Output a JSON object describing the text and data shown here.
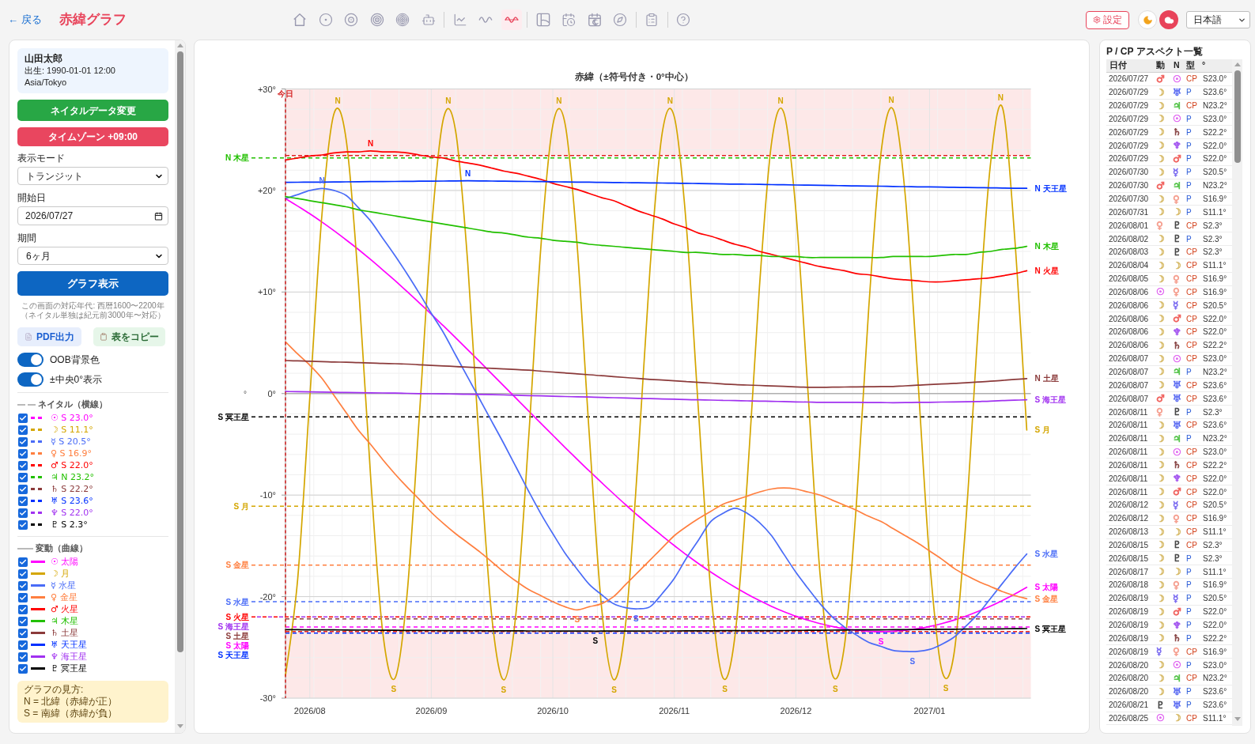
{
  "header": {
    "back_link": "← 戻る",
    "title": "赤緯グラフ",
    "toolbar": [
      [
        {
          "kind": "home",
          "selected": false
        },
        {
          "kind": "circle-dot",
          "selected": false
        },
        {
          "kind": "rings-2",
          "selected": false
        },
        {
          "kind": "rings-3",
          "selected": false
        },
        {
          "kind": "rings-4",
          "selected": false
        },
        {
          "kind": "robot",
          "selected": false
        }
      ],
      [
        {
          "kind": "line-chart",
          "selected": false
        },
        {
          "kind": "wave",
          "selected": false
        },
        {
          "kind": "wave-axis",
          "selected": true
        }
      ],
      [
        {
          "kind": "grid",
          "selected": false
        },
        {
          "kind": "calendar-clock",
          "selected": false
        },
        {
          "kind": "calendar-moon",
          "selected": false
        },
        {
          "kind": "compass",
          "selected": false
        }
      ],
      [
        {
          "kind": "clipboard",
          "selected": false
        }
      ],
      [
        {
          "kind": "help",
          "selected": false
        }
      ]
    ],
    "settings": "設定",
    "theme_buttons": [
      {
        "kind": "moon",
        "selected": false
      },
      {
        "kind": "cloud",
        "selected": true
      }
    ],
    "language": "日本語"
  },
  "sidebar": {
    "profile": {
      "name": "山田太郎",
      "birth": "出生: 1990-01-01 12:00",
      "timezone": "Asia/Tokyo"
    },
    "actions": [
      {
        "label": "ネイタルデータ変更",
        "color": "#28a745"
      },
      {
        "label": "タイムゾーン +09:00",
        "color": "#e9465f"
      }
    ],
    "fields": [
      {
        "label": "表示モード",
        "kind": "select",
        "value": "トランジット"
      },
      {
        "label": "開始日",
        "kind": "date",
        "value": "2026/07/27"
      },
      {
        "label": "期間",
        "kind": "select",
        "value": "6ヶ月"
      }
    ],
    "submit": "グラフ表示",
    "note": "この画面の対応年代: 西暦1600〜2200年（ネイタル単独は紀元前3000年〜対応）",
    "exports": [
      {
        "label": "PDF出力",
        "kind": "pdf"
      },
      {
        "label": "表をコピー",
        "kind": "copy"
      }
    ],
    "toggles": [
      {
        "label": "OOB背景色",
        "on": true
      },
      {
        "label": "±中央0°表示",
        "on": true
      }
    ],
    "natal_legend": {
      "title": "ネイタル（横線）",
      "items": [
        {
          "label": "☉ S 23.0°",
          "color": "#ff00ff",
          "checked": true
        },
        {
          "label": "☽ S 11.1°",
          "color": "#d4a600",
          "checked": true
        },
        {
          "label": "☿ S 20.5°",
          "color": "#4a6cf7",
          "checked": true
        },
        {
          "label": "♀ S 16.9°",
          "color": "#ff7f3f",
          "checked": true
        },
        {
          "label": "♂ S 22.0°",
          "color": "#ff0000",
          "checked": true
        },
        {
          "label": "♃ N 23.2°",
          "color": "#22c000",
          "checked": true
        },
        {
          "label": "♄ S 22.2°",
          "color": "#8b3a3a",
          "checked": true
        },
        {
          "label": "♅ S 23.6°",
          "color": "#0030ff",
          "checked": true
        },
        {
          "label": "♆ S 22.0°",
          "color": "#a030f0",
          "checked": true
        },
        {
          "label": "♇ S 2.3°",
          "color": "#000000",
          "checked": true
        }
      ]
    },
    "transit_legend": {
      "title": "変動（曲線）",
      "items": [
        {
          "label": "☉ 太陽",
          "color": "#ff00ff",
          "checked": true
        },
        {
          "label": "☽ 月",
          "color": "#d4a600",
          "checked": true
        },
        {
          "label": "☿ 水星",
          "color": "#4a6cf7",
          "checked": true
        },
        {
          "label": "♀ 金星",
          "color": "#ff7f3f",
          "checked": true
        },
        {
          "label": "♂ 火星",
          "color": "#ff0000",
          "checked": true
        },
        {
          "label": "♃ 木星",
          "color": "#22c000",
          "checked": true
        },
        {
          "label": "♄ 土星",
          "color": "#8b3a3a",
          "checked": true
        },
        {
          "label": "♅ 天王星",
          "color": "#0030ff",
          "checked": true
        },
        {
          "label": "♆ 海王星",
          "color": "#a030f0",
          "checked": true
        },
        {
          "label": "♇ 冥王星",
          "color": "#000000",
          "checked": true
        }
      ]
    },
    "help": {
      "title": "グラフの見方:",
      "lines": [
        "N = 北緯（赤緯が正）",
        "S = 南緯（赤緯が負）"
      ]
    }
  },
  "chart_panel": {
    "chart_data": {
      "type": "line",
      "title": "赤緯（±符号付き・0°中心）",
      "ylabel": "°",
      "grid": true,
      "categories": [
        null,
        null,
        "2026/08",
        null,
        null,
        null,
        null,
        null,
        null,
        null,
        null,
        null,
        "2026/09",
        null,
        null,
        null,
        null,
        null,
        null,
        null,
        null,
        null,
        "2026/10",
        null,
        null,
        null,
        null,
        null,
        null,
        null,
        null,
        null,
        "2026/11",
        null,
        null,
        null,
        null,
        null,
        null,
        null,
        null,
        null,
        "2026/12",
        null,
        null,
        null,
        null,
        null,
        null,
        null,
        null,
        null,
        null,
        "2027/01",
        null,
        null,
        null,
        null,
        null,
        null,
        null,
        null
      ],
      "ylim": [
        -30,
        30
      ],
      "yticks": [
        {
          "value": 30,
          "label": "+30°"
        },
        {
          "value": 20,
          "label": "+20°"
        },
        {
          "value": 10,
          "label": "+10°"
        },
        {
          "value": 0,
          "label": "0°"
        },
        {
          "value": -10,
          "label": "-10°"
        },
        {
          "value": -20,
          "label": "-20°"
        },
        {
          "value": -30,
          "label": "-30°"
        }
      ],
      "series": [
        {
          "name": "S 太陽",
          "color": "#ff00ff",
          "values": [
            19.2,
            18.47,
            17.71,
            16.89,
            16.03,
            15.13,
            14.19,
            13.2,
            12.18,
            11.14,
            10.05,
            8.95,
            7.82,
            6.66,
            5.5,
            4.31,
            3.12,
            1.91,
            0.71,
            -0.5,
            -1.71,
            -2.92,
            -4.11,
            -5.3,
            -6.47,
            -7.63,
            -8.76,
            -9.87,
            -10.96,
            -12.01,
            -13.03,
            -14.02,
            -14.97,
            -15.89,
            -16.76,
            -17.58,
            -18.35,
            -19.08,
            -19.76,
            -20.38,
            -20.96,
            -21.47,
            -21.93,
            -22.33,
            -22.66,
            -22.94,
            -23.16,
            -23.32,
            -23.41,
            -23.44,
            -23.41,
            -23.31,
            -23.16,
            -22.94,
            -22.66,
            -22.32,
            -21.92,
            -21.46,
            -20.95,
            -20.38,
            -19.76,
            -19.08
          ]
        },
        {
          "name": "S 月",
          "color": "#d4a600",
          "values": [
            -27.77,
            -18.3,
            -0.45,
            17.61,
            27.6,
            24.97,
            10.93,
            -8.12,
            -23.45,
            -28.06,
            -19.83,
            -2.53,
            15.93,
            27.1,
            25.87,
            12.81,
            -6.11,
            -22.23,
            -28.19,
            -21.24,
            -4.59,
            14.17,
            26.45,
            26.63,
            14.62,
            -4.07,
            -20.9,
            -28.17,
            -22.55,
            -6.63,
            12.34,
            25.66,
            27.24,
            16.36,
            -2.0,
            -19.45,
            -28.0,
            -23.74,
            -8.63,
            10.44,
            24.72,
            27.7,
            18.01,
            0.07,
            -17.89,
            -27.67,
            -24.8,
            -10.58,
            8.48,
            23.67,
            28.01,
            19.54,
            2.15,
            -16.24,
            -27.2,
            -25.72,
            -12.47,
            6.48,
            22.46,
            28.18,
            15.5,
            -3.6
          ]
        },
        {
          "name": "S 水星",
          "color": "#4a6cf7",
          "values": [
            19.2,
            19.6,
            20.0,
            20.2,
            20.0,
            19.5,
            18.3,
            17.0,
            15.3,
            13.6,
            11.8,
            9.9,
            7.9,
            6.0,
            3.8,
            1.6,
            -0.6,
            -2.8,
            -5.0,
            -7.3,
            -9.6,
            -11.8,
            -13.8,
            -15.7,
            -17.3,
            -18.8,
            -19.8,
            -20.7,
            -21.1,
            -21.2,
            -21.0,
            -19.7,
            -18.2,
            -16.2,
            -14.4,
            -12.6,
            -11.8,
            -11.3,
            -11.8,
            -12.7,
            -14.0,
            -15.8,
            -17.6,
            -19.2,
            -20.7,
            -22.0,
            -23.0,
            -23.8,
            -24.5,
            -24.9,
            -25.3,
            -25.4,
            -25.4,
            -25.2,
            -24.7,
            -24.0,
            -22.9,
            -21.7,
            -20.2,
            -18.7,
            -17.2,
            -15.8
          ]
        },
        {
          "name": "S 金星",
          "color": "#ff7f3f",
          "values": [
            5.1,
            3.9,
            2.8,
            1.5,
            -0.2,
            -1.9,
            -3.6,
            -5.0,
            -6.5,
            -7.9,
            -9.2,
            -10.4,
            -11.7,
            -12.8,
            -13.8,
            -14.7,
            -15.6,
            -16.6,
            -17.6,
            -18.5,
            -19.3,
            -19.9,
            -20.5,
            -21.0,
            -21.3,
            -21.0,
            -20.7,
            -20.0,
            -18.8,
            -17.6,
            -16.4,
            -15.2,
            -14.0,
            -13.1,
            -12.3,
            -11.6,
            -10.9,
            -10.5,
            -10.1,
            -9.7,
            -9.4,
            -9.3,
            -9.4,
            -9.7,
            -10.0,
            -10.5,
            -11.0,
            -11.5,
            -12.1,
            -12.6,
            -13.3,
            -14.0,
            -14.7,
            -15.5,
            -16.3,
            -17.2,
            -17.9,
            -18.5,
            -19.0,
            -19.5,
            -19.9,
            -20.2
          ]
        },
        {
          "name": "N 火星",
          "color": "#ff0000",
          "values": [
            23.0,
            23.2,
            23.4,
            23.5,
            23.7,
            23.8,
            23.8,
            23.9,
            23.8,
            23.8,
            23.7,
            23.5,
            23.3,
            23.2,
            22.9,
            22.7,
            22.5,
            22.2,
            21.9,
            21.7,
            21.4,
            21.1,
            20.7,
            20.4,
            20.1,
            19.7,
            19.3,
            19.0,
            18.5,
            18.0,
            17.6,
            17.2,
            16.7,
            16.3,
            15.8,
            15.5,
            15.1,
            14.7,
            14.4,
            14.0,
            13.7,
            13.4,
            13.1,
            12.8,
            12.5,
            12.3,
            12.1,
            11.8,
            11.7,
            11.5,
            11.3,
            11.2,
            11.1,
            11.0,
            11.0,
            11.1,
            11.2,
            11.3,
            11.4,
            11.6,
            11.8,
            12.1
          ]
        },
        {
          "name": "N 木星",
          "color": "#22c000",
          "values": [
            19.4,
            19.2,
            19.0,
            18.8,
            18.6,
            18.4,
            18.1,
            17.9,
            17.7,
            17.5,
            17.3,
            17.1,
            16.9,
            16.7,
            16.5,
            16.3,
            16.1,
            15.9,
            15.8,
            15.6,
            15.4,
            15.3,
            15.1,
            15.0,
            14.9,
            14.7,
            14.6,
            14.5,
            14.4,
            14.3,
            14.2,
            14.1,
            14.0,
            13.9,
            13.9,
            13.8,
            13.7,
            13.7,
            13.6,
            13.6,
            13.5,
            13.5,
            13.5,
            13.4,
            13.4,
            13.4,
            13.4,
            13.4,
            13.4,
            13.4,
            13.5,
            13.5,
            13.5,
            13.5,
            13.6,
            13.7,
            13.7,
            13.9,
            14.0,
            14.2,
            14.3,
            14.5
          ]
        },
        {
          "name": "N 土星",
          "color": "#8b3a3a",
          "values": [
            3.25,
            3.22,
            3.18,
            3.15,
            3.11,
            3.08,
            3.04,
            3.01,
            2.97,
            2.94,
            2.9,
            2.84,
            2.78,
            2.72,
            2.66,
            2.6,
            2.54,
            2.48,
            2.42,
            2.36,
            2.3,
            2.21,
            2.12,
            2.03,
            1.94,
            1.85,
            1.76,
            1.67,
            1.58,
            1.49,
            1.4,
            1.33,
            1.25,
            1.18,
            1.1,
            1.03,
            0.95,
            0.89,
            0.84,
            0.8,
            0.75,
            0.71,
            0.66,
            0.62,
            0.61,
            0.63,
            0.64,
            0.66,
            0.67,
            0.69,
            0.7,
            0.76,
            0.82,
            0.88,
            0.94,
            1.0,
            1.06,
            1.13,
            1.21,
            1.3,
            1.39,
            1.47
          ]
        },
        {
          "name": "N 天王星",
          "color": "#0030ff",
          "values": [
            20.8,
            20.81,
            20.82,
            20.83,
            20.84,
            20.85,
            20.86,
            20.87,
            20.88,
            20.89,
            20.9,
            20.91,
            20.92,
            20.93,
            20.94,
            20.95,
            20.94,
            20.93,
            20.91,
            20.9,
            20.89,
            20.87,
            20.86,
            20.84,
            20.83,
            20.82,
            20.8,
            20.79,
            20.77,
            20.76,
            20.75,
            20.73,
            20.72,
            20.7,
            20.69,
            20.67,
            20.65,
            20.63,
            20.62,
            20.6,
            20.58,
            20.56,
            20.54,
            20.53,
            20.51,
            20.49,
            20.47,
            20.45,
            20.44,
            20.42,
            20.4,
            20.38,
            20.36,
            20.35,
            20.33,
            20.31,
            20.29,
            20.28,
            20.26,
            20.24,
            20.22,
            20.21
          ]
        },
        {
          "name": "S 海王星",
          "color": "#a030f0",
          "values": [
            0.2,
            0.18,
            0.16,
            0.15,
            0.13,
            0.11,
            0.09,
            0.07,
            0.06,
            0.04,
            0.02,
            0.0,
            -0.02,
            -0.03,
            -0.05,
            -0.07,
            -0.09,
            -0.11,
            -0.14,
            -0.17,
            -0.2,
            -0.23,
            -0.26,
            -0.29,
            -0.32,
            -0.35,
            -0.38,
            -0.41,
            -0.44,
            -0.47,
            -0.5,
            -0.53,
            -0.56,
            -0.59,
            -0.62,
            -0.64,
            -0.67,
            -0.69,
            -0.72,
            -0.74,
            -0.77,
            -0.79,
            -0.82,
            -0.84,
            -0.86,
            -0.86,
            -0.87,
            -0.87,
            -0.88,
            -0.89,
            -0.9,
            -0.89,
            -0.87,
            -0.86,
            -0.84,
            -0.83,
            -0.81,
            -0.79,
            -0.74,
            -0.7,
            -0.66,
            -0.61
          ]
        },
        {
          "name": "S 冥王星",
          "color": "#000000",
          "values": [
            -23.25,
            -23.26,
            -23.27,
            -23.27,
            -23.28,
            -23.29,
            -23.3,
            -23.3,
            -23.31,
            -23.32,
            -23.33,
            -23.33,
            -23.34,
            -23.35,
            -23.35,
            -23.36,
            -23.36,
            -23.37,
            -23.37,
            -23.37,
            -23.38,
            -23.38,
            -23.39,
            -23.39,
            -23.39,
            -23.4,
            -23.4,
            -23.39,
            -23.39,
            -23.39,
            -23.38,
            -23.38,
            -23.38,
            -23.37,
            -23.37,
            -23.37,
            -23.36,
            -23.36,
            -23.36,
            -23.35,
            -23.35,
            -23.34,
            -23.33,
            -23.32,
            -23.31,
            -23.3,
            -23.29,
            -23.28,
            -23.28,
            -23.27,
            -23.26,
            -23.25,
            -23.24,
            -23.23,
            -23.22,
            -23.21,
            -23.2,
            -23.19,
            -23.18,
            -23.17,
            -23.16,
            -23.15
          ]
        }
      ],
      "bands": [
        {
          "axis": "y",
          "from": 23.44,
          "to": 30
        },
        {
          "axis": "y",
          "from": -30,
          "to": -23.44
        }
      ],
      "ref_lines": [
        {
          "axis": "y",
          "value": 23.44,
          "color": "#e02020"
        },
        {
          "axis": "y",
          "value": -23.44,
          "color": "#e02020"
        },
        {
          "axis": "y",
          "value": -23.0,
          "label": "S 太陽",
          "color": "#ff00ff"
        },
        {
          "axis": "y",
          "value": -11.1,
          "label": "S 月",
          "color": "#d4a600"
        },
        {
          "axis": "y",
          "value": -20.5,
          "label": "S 水星",
          "color": "#4a6cf7"
        },
        {
          "axis": "y",
          "value": -16.9,
          "label": "S 金星",
          "color": "#ff7f3f"
        },
        {
          "axis": "y",
          "value": -22.0,
          "label": "S 火星",
          "color": "#ff0000"
        },
        {
          "axis": "y",
          "value": 23.2,
          "label": "N 木星",
          "color": "#22c000"
        },
        {
          "axis": "y",
          "value": -22.2,
          "label": "S 土星",
          "color": "#8b3a3a"
        },
        {
          "axis": "y",
          "value": -23.6,
          "label": "S 天王星",
          "color": "#0030ff"
        },
        {
          "axis": "y",
          "value": -22.0,
          "label": "S 海王星",
          "color": "#a030f0"
        },
        {
          "axis": "y",
          "value": -2.3,
          "label": "S 冥王星",
          "color": "#000000"
        }
      ],
      "annotations": [
        "今日",
        {
          "text": "N",
          "y": 27.6
        },
        {
          "text": "N",
          "y": 27.1
        },
        {
          "text": "N",
          "y": 26.63
        },
        {
          "text": "N",
          "y": 27.24
        },
        {
          "text": "N",
          "y": 27.7
        },
        {
          "text": "N",
          "y": 28.01
        },
        {
          "text": "N",
          "y": 28.18
        },
        {
          "text": "S",
          "y": -28.06
        },
        {
          "text": "S",
          "y": -28.19
        },
        {
          "text": "S",
          "y": -28.17
        },
        {
          "text": "S",
          "y": -28.0
        },
        {
          "text": "S",
          "y": -27.67
        },
        {
          "text": "S",
          "y": -27.2
        },
        {
          "text": "N",
          "y": 20.2
        },
        {
          "text": "N",
          "y": 23.9
        },
        {
          "text": "N",
          "y": 20.95
        },
        {
          "text": "S",
          "y": -21.3
        },
        {
          "text": "S",
          "y": -23.4
        },
        {
          "text": "S",
          "y": -21.2
        },
        {
          "text": "S",
          "y": -23.44
        },
        {
          "text": "S",
          "y": -25.4
        }
      ]
    }
  },
  "aspects": {
    "title": "P / CP アスペクト一覧",
    "columns": [
      "日付",
      "動",
      "N",
      "型",
      "°"
    ],
    "rows": [
      {
        "date": "2026/07/27",
        "moving": {
          "glyph": "♂",
          "color": "#f0605c"
        },
        "natal": {
          "glyph": "☉",
          "color": "#e066f0"
        },
        "type": "CP",
        "kind": "cp",
        "value": "S23.0°"
      },
      {
        "date": "2026/07/29",
        "moving": {
          "glyph": "☽",
          "color": "#d8bc6c"
        },
        "natal": {
          "glyph": "♅",
          "color": "#5b6cf2"
        },
        "type": "P",
        "kind": "p",
        "value": "S23.6°"
      },
      {
        "date": "2026/07/29",
        "moving": {
          "glyph": "☽",
          "color": "#d8bc6c"
        },
        "natal": {
          "glyph": "♃",
          "color": "#55c44a"
        },
        "type": "CP",
        "kind": "cp",
        "value": "N23.2°"
      },
      {
        "date": "2026/07/29",
        "moving": {
          "glyph": "☽",
          "color": "#d8bc6c"
        },
        "natal": {
          "glyph": "☉",
          "color": "#e066f0"
        },
        "type": "P",
        "kind": "p",
        "value": "S23.0°"
      },
      {
        "date": "2026/07/29",
        "moving": {
          "glyph": "☽",
          "color": "#d8bc6c"
        },
        "natal": {
          "glyph": "♄",
          "color": "#8a4848"
        },
        "type": "P",
        "kind": "p",
        "value": "S22.2°"
      },
      {
        "date": "2026/07/29",
        "moving": {
          "glyph": "☽",
          "color": "#d8bc6c"
        },
        "natal": {
          "glyph": "♆",
          "color": "#a65af0"
        },
        "type": "P",
        "kind": "p",
        "value": "S22.0°"
      },
      {
        "date": "2026/07/29",
        "moving": {
          "glyph": "☽",
          "color": "#d8bc6c"
        },
        "natal": {
          "glyph": "♂",
          "color": "#f0605c"
        },
        "type": "P",
        "kind": "p",
        "value": "S22.0°"
      },
      {
        "date": "2026/07/30",
        "moving": {
          "glyph": "☽",
          "color": "#d8bc6c"
        },
        "natal": {
          "glyph": "☿",
          "color": "#7b6cf0"
        },
        "type": "P",
        "kind": "p",
        "value": "S20.5°"
      },
      {
        "date": "2026/07/30",
        "moving": {
          "glyph": "♂",
          "color": "#f0605c"
        },
        "natal": {
          "glyph": "♃",
          "color": "#55c44a"
        },
        "type": "P",
        "kind": "p",
        "value": "N23.2°"
      },
      {
        "date": "2026/07/30",
        "moving": {
          "glyph": "☽",
          "color": "#d8bc6c"
        },
        "natal": {
          "glyph": "♀",
          "color": "#f59c8c"
        },
        "type": "P",
        "kind": "p",
        "value": "S16.9°"
      },
      {
        "date": "2026/07/31",
        "moving": {
          "glyph": "☽",
          "color": "#d8bc6c"
        },
        "natal": {
          "glyph": "☽",
          "color": "#d8bc6c"
        },
        "type": "P",
        "kind": "p",
        "value": "S11.1°"
      },
      {
        "date": "2026/08/01",
        "moving": {
          "glyph": "♀",
          "color": "#f59c8c"
        },
        "natal": {
          "glyph": "♇",
          "color": "#444444"
        },
        "type": "CP",
        "kind": "cp",
        "value": "S2.3°"
      },
      {
        "date": "2026/08/02",
        "moving": {
          "glyph": "☽",
          "color": "#d8bc6c"
        },
        "natal": {
          "glyph": "♇",
          "color": "#444444"
        },
        "type": "P",
        "kind": "p",
        "value": "S2.3°"
      },
      {
        "date": "2026/08/03",
        "moving": {
          "glyph": "☽",
          "color": "#d8bc6c"
        },
        "natal": {
          "glyph": "♇",
          "color": "#444444"
        },
        "type": "CP",
        "kind": "cp",
        "value": "S2.3°"
      },
      {
        "date": "2026/08/04",
        "moving": {
          "glyph": "☽",
          "color": "#d8bc6c"
        },
        "natal": {
          "glyph": "☽",
          "color": "#d8bc6c"
        },
        "type": "CP",
        "kind": "cp",
        "value": "S11.1°"
      },
      {
        "date": "2026/08/05",
        "moving": {
          "glyph": "☽",
          "color": "#d8bc6c"
        },
        "natal": {
          "glyph": "♀",
          "color": "#f59c8c"
        },
        "type": "CP",
        "kind": "cp",
        "value": "S16.9°"
      },
      {
        "date": "2026/08/06",
        "moving": {
          "glyph": "☉",
          "color": "#e066f0"
        },
        "natal": {
          "glyph": "♀",
          "color": "#f59c8c"
        },
        "type": "CP",
        "kind": "cp",
        "value": "S16.9°"
      },
      {
        "date": "2026/08/06",
        "moving": {
          "glyph": "☽",
          "color": "#d8bc6c"
        },
        "natal": {
          "glyph": "☿",
          "color": "#7b6cf0"
        },
        "type": "CP",
        "kind": "cp",
        "value": "S20.5°"
      },
      {
        "date": "2026/08/06",
        "moving": {
          "glyph": "☽",
          "color": "#d8bc6c"
        },
        "natal": {
          "glyph": "♂",
          "color": "#f0605c"
        },
        "type": "CP",
        "kind": "cp",
        "value": "S22.0°"
      },
      {
        "date": "2026/08/06",
        "moving": {
          "glyph": "☽",
          "color": "#d8bc6c"
        },
        "natal": {
          "glyph": "♆",
          "color": "#a65af0"
        },
        "type": "CP",
        "kind": "cp",
        "value": "S22.0°"
      },
      {
        "date": "2026/08/06",
        "moving": {
          "glyph": "☽",
          "color": "#d8bc6c"
        },
        "natal": {
          "glyph": "♄",
          "color": "#8a4848"
        },
        "type": "CP",
        "kind": "cp",
        "value": "S22.2°"
      },
      {
        "date": "2026/08/07",
        "moving": {
          "glyph": "☽",
          "color": "#d8bc6c"
        },
        "natal": {
          "glyph": "☉",
          "color": "#e066f0"
        },
        "type": "CP",
        "kind": "cp",
        "value": "S23.0°"
      },
      {
        "date": "2026/08/07",
        "moving": {
          "glyph": "☽",
          "color": "#d8bc6c"
        },
        "natal": {
          "glyph": "♃",
          "color": "#55c44a"
        },
        "type": "P",
        "kind": "p",
        "value": "N23.2°"
      },
      {
        "date": "2026/08/07",
        "moving": {
          "glyph": "☽",
          "color": "#d8bc6c"
        },
        "natal": {
          "glyph": "♅",
          "color": "#5b6cf2"
        },
        "type": "CP",
        "kind": "cp",
        "value": "S23.6°"
      },
      {
        "date": "2026/08/07",
        "moving": {
          "glyph": "♂",
          "color": "#f0605c"
        },
        "natal": {
          "glyph": "♅",
          "color": "#5b6cf2"
        },
        "type": "CP",
        "kind": "cp",
        "value": "S23.6°"
      },
      {
        "date": "2026/08/11",
        "moving": {
          "glyph": "♀",
          "color": "#f59c8c"
        },
        "natal": {
          "glyph": "♇",
          "color": "#444444"
        },
        "type": "P",
        "kind": "p",
        "value": "S2.3°"
      },
      {
        "date": "2026/08/11",
        "moving": {
          "glyph": "☽",
          "color": "#d8bc6c"
        },
        "natal": {
          "glyph": "♅",
          "color": "#5b6cf2"
        },
        "type": "CP",
        "kind": "cp",
        "value": "S23.6°"
      },
      {
        "date": "2026/08/11",
        "moving": {
          "glyph": "☽",
          "color": "#d8bc6c"
        },
        "natal": {
          "glyph": "♃",
          "color": "#55c44a"
        },
        "type": "P",
        "kind": "p",
        "value": "N23.2°"
      },
      {
        "date": "2026/08/11",
        "moving": {
          "glyph": "☽",
          "color": "#d8bc6c"
        },
        "natal": {
          "glyph": "☉",
          "color": "#e066f0"
        },
        "type": "CP",
        "kind": "cp",
        "value": "S23.0°"
      },
      {
        "date": "2026/08/11",
        "moving": {
          "glyph": "☽",
          "color": "#d8bc6c"
        },
        "natal": {
          "glyph": "♄",
          "color": "#8a4848"
        },
        "type": "CP",
        "kind": "cp",
        "value": "S22.2°"
      },
      {
        "date": "2026/08/11",
        "moving": {
          "glyph": "☽",
          "color": "#d8bc6c"
        },
        "natal": {
          "glyph": "♆",
          "color": "#a65af0"
        },
        "type": "CP",
        "kind": "cp",
        "value": "S22.0°"
      },
      {
        "date": "2026/08/11",
        "moving": {
          "glyph": "☽",
          "color": "#d8bc6c"
        },
        "natal": {
          "glyph": "♂",
          "color": "#f0605c"
        },
        "type": "CP",
        "kind": "cp",
        "value": "S22.0°"
      },
      {
        "date": "2026/08/12",
        "moving": {
          "glyph": "☽",
          "color": "#d8bc6c"
        },
        "natal": {
          "glyph": "☿",
          "color": "#7b6cf0"
        },
        "type": "CP",
        "kind": "cp",
        "value": "S20.5°"
      },
      {
        "date": "2026/08/12",
        "moving": {
          "glyph": "☽",
          "color": "#d8bc6c"
        },
        "natal": {
          "glyph": "♀",
          "color": "#f59c8c"
        },
        "type": "CP",
        "kind": "cp",
        "value": "S16.9°"
      },
      {
        "date": "2026/08/13",
        "moving": {
          "glyph": "☽",
          "color": "#d8bc6c"
        },
        "natal": {
          "glyph": "☽",
          "color": "#d8bc6c"
        },
        "type": "CP",
        "kind": "cp",
        "value": "S11.1°"
      },
      {
        "date": "2026/08/15",
        "moving": {
          "glyph": "☽",
          "color": "#d8bc6c"
        },
        "natal": {
          "glyph": "♇",
          "color": "#444444"
        },
        "type": "CP",
        "kind": "cp",
        "value": "S2.3°"
      },
      {
        "date": "2026/08/15",
        "moving": {
          "glyph": "☽",
          "color": "#d8bc6c"
        },
        "natal": {
          "glyph": "♇",
          "color": "#444444"
        },
        "type": "P",
        "kind": "p",
        "value": "S2.3°"
      },
      {
        "date": "2026/08/17",
        "moving": {
          "glyph": "☽",
          "color": "#d8bc6c"
        },
        "natal": {
          "glyph": "☽",
          "color": "#d8bc6c"
        },
        "type": "P",
        "kind": "p",
        "value": "S11.1°"
      },
      {
        "date": "2026/08/18",
        "moving": {
          "glyph": "☽",
          "color": "#d8bc6c"
        },
        "natal": {
          "glyph": "♀",
          "color": "#f59c8c"
        },
        "type": "P",
        "kind": "p",
        "value": "S16.9°"
      },
      {
        "date": "2026/08/19",
        "moving": {
          "glyph": "☽",
          "color": "#d8bc6c"
        },
        "natal": {
          "glyph": "☿",
          "color": "#7b6cf0"
        },
        "type": "P",
        "kind": "p",
        "value": "S20.5°"
      },
      {
        "date": "2026/08/19",
        "moving": {
          "glyph": "☽",
          "color": "#d8bc6c"
        },
        "natal": {
          "glyph": "♂",
          "color": "#f0605c"
        },
        "type": "P",
        "kind": "p",
        "value": "S22.0°"
      },
      {
        "date": "2026/08/19",
        "moving": {
          "glyph": "☽",
          "color": "#d8bc6c"
        },
        "natal": {
          "glyph": "♆",
          "color": "#a65af0"
        },
        "type": "P",
        "kind": "p",
        "value": "S22.0°"
      },
      {
        "date": "2026/08/19",
        "moving": {
          "glyph": "☽",
          "color": "#d8bc6c"
        },
        "natal": {
          "glyph": "♄",
          "color": "#8a4848"
        },
        "type": "P",
        "kind": "p",
        "value": "S22.2°"
      },
      {
        "date": "2026/08/19",
        "moving": {
          "glyph": "☿",
          "color": "#7b6cf0"
        },
        "natal": {
          "glyph": "♀",
          "color": "#f59c8c"
        },
        "type": "CP",
        "kind": "cp",
        "value": "S16.9°"
      },
      {
        "date": "2026/08/20",
        "moving": {
          "glyph": "☽",
          "color": "#d8bc6c"
        },
        "natal": {
          "glyph": "☉",
          "color": "#e066f0"
        },
        "type": "P",
        "kind": "p",
        "value": "S23.0°"
      },
      {
        "date": "2026/08/20",
        "moving": {
          "glyph": "☽",
          "color": "#d8bc6c"
        },
        "natal": {
          "glyph": "♃",
          "color": "#55c44a"
        },
        "type": "CP",
        "kind": "cp",
        "value": "N23.2°"
      },
      {
        "date": "2026/08/20",
        "moving": {
          "glyph": "☽",
          "color": "#d8bc6c"
        },
        "natal": {
          "glyph": "♅",
          "color": "#5b6cf2"
        },
        "type": "P",
        "kind": "p",
        "value": "S23.6°"
      },
      {
        "date": "2026/08/21",
        "moving": {
          "glyph": "♇",
          "color": "#444444"
        },
        "natal": {
          "glyph": "♅",
          "color": "#5b6cf2"
        },
        "type": "P",
        "kind": "p",
        "value": "S23.6°"
      },
      {
        "date": "2026/08/25",
        "moving": {
          "glyph": "☉",
          "color": "#e066f0"
        },
        "natal": {
          "glyph": "☽",
          "color": "#d8bc6c"
        },
        "type": "CP",
        "kind": "cp",
        "value": "S11.1°"
      }
    ]
  }
}
